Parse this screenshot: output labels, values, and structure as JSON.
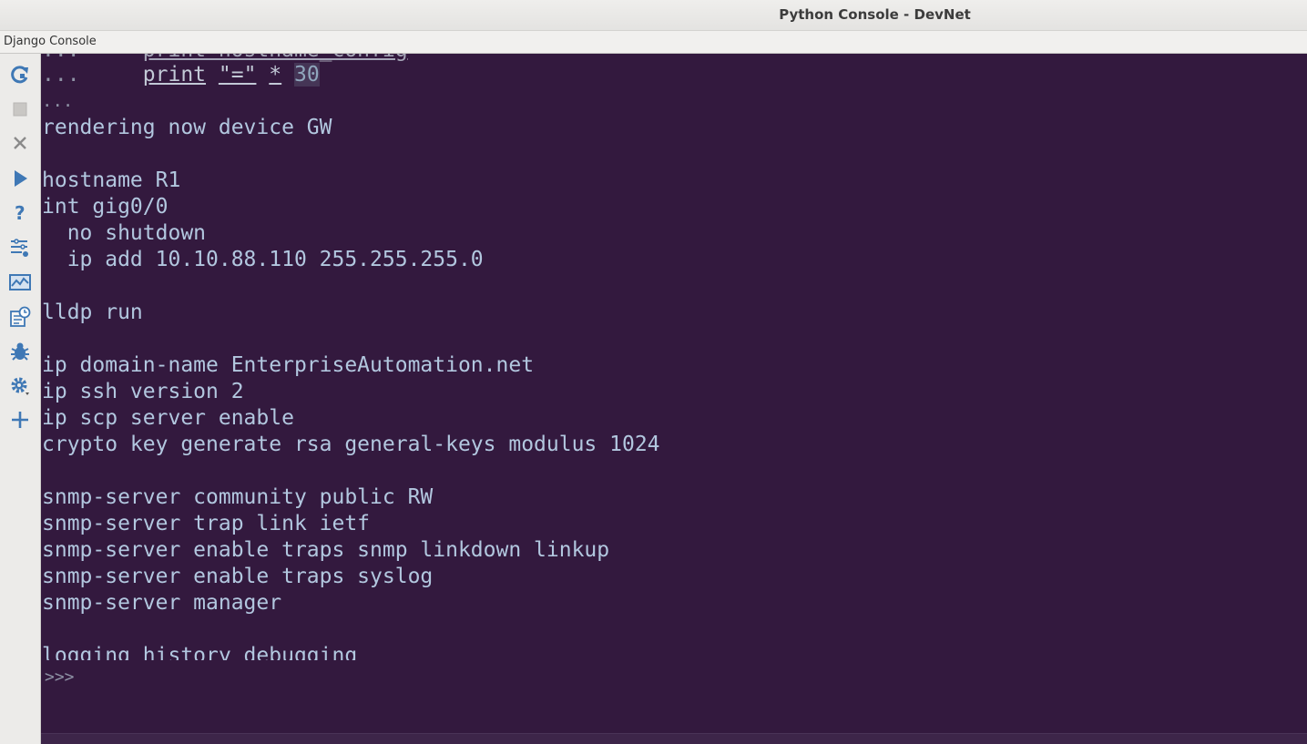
{
  "window": {
    "title": "Python Console - DevNet"
  },
  "tab": {
    "label": "Django Console"
  },
  "toolbar": {
    "icons": [
      "rerun-icon",
      "stop-icon",
      "close-icon",
      "execute-icon",
      "help-icon",
      "settings-list-icon",
      "variables-icon",
      "history-icon",
      "debug-icon",
      "gear-icon",
      "add-icon"
    ]
  },
  "console": {
    "partial_line": "...     print hostname_config",
    "code_line": {
      "dots": "...     ",
      "kw": "print",
      "str": "\"=\"",
      "op": "*",
      "num": "30"
    },
    "dots_line": "...",
    "output_lines": [
      "rendering now device GW",
      "",
      "hostname R1",
      "int gig0/0",
      "  no shutdown",
      "  ip add 10.10.88.110 255.255.255.0",
      "",
      "lldp run",
      "",
      "ip domain-name EnterpriseAutomation.net",
      "ip ssh version 2",
      "ip scp server enable",
      "crypto key generate rsa general-keys modulus 1024",
      "",
      "snmp-server community public RW",
      "snmp-server trap link ietf",
      "snmp-server enable traps snmp linkdown linkup",
      "snmp-server enable traps syslog",
      "snmp-server manager",
      "",
      "logging history debugging"
    ],
    "input_prompt": ">>>"
  },
  "colors": {
    "console_bg": "#33193e",
    "output_text": "#b2c7df",
    "prompt_text": "#8f93a6"
  }
}
